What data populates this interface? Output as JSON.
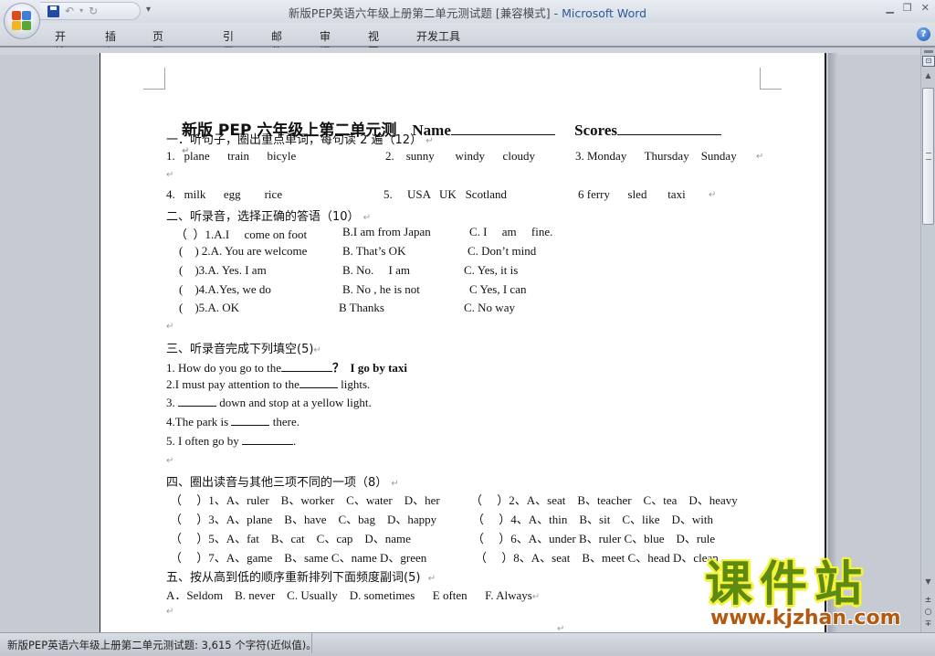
{
  "window": {
    "title_doc": "新版PEP英语六年级上册第二单元测试题 [兼容模式] - ",
    "title_app": "Microsoft Word",
    "controls": [
      "minimize",
      "restore",
      "close"
    ]
  },
  "quick_access": {
    "save": "save-icon",
    "undo": "↶",
    "undo_dropdown": "▾",
    "redo": "↻",
    "customize": "▾"
  },
  "ribbon": {
    "tabs": [
      "开始",
      "插入",
      "页面布局",
      "引用",
      "邮件",
      "审阅",
      "视图",
      "开发工具"
    ],
    "help": "?"
  },
  "document": {
    "title": {
      "text": "新版 PEP 六年级上第二单元测",
      "name_label": "Name",
      "scores_label": "Scores"
    },
    "section1": {
      "heading": "一．听句子，圈出重点单词，每句读 2 遍（12）",
      "row1": {
        "g1": "1.   plane      train      bicyle",
        "g2": "2.    sunny       windy      cloudy",
        "g3": "3. Monday      Thursday    Sunday"
      },
      "row2": {
        "g1": "4.   milk      egg        rice",
        "g2": "5.     USA   UK   Scotland",
        "g3": "6 ferry      sled       taxi"
      }
    },
    "section2": {
      "heading": "二、听录音，选择正确的答语（10）",
      "items": [
        {
          "a": "（  ）1.A.I     come on foot",
          "b": "B.I am from Japan",
          "c": "C. I     am     fine."
        },
        {
          "a": "(    ) 2.A. You are welcome",
          "b": "B. That’s OK",
          "c": "C. Don’t mind"
        },
        {
          "a": "(    )3.A. Yes. I am",
          "b": "B. No.     I am",
          "c": "C. Yes, it is"
        },
        {
          "a": "(    )4.A.Yes, we do",
          "b": "B. No , he is not",
          "c": "C Yes, I can"
        },
        {
          "a": "(    )5.A. OK",
          "b": "B Thanks",
          "c": "C. No way"
        }
      ]
    },
    "section3": {
      "heading": "三、听录音完成下列填空(5)",
      "items": [
        {
          "before": "1. How do you go to the",
          "after": "？  I go by taxi"
        },
        {
          "before": "2.I must pay attention to the",
          "after": " lights."
        },
        {
          "before": "3. ",
          "after": " down and stop at a yellow light."
        },
        {
          "before": "4.The park is ",
          "after": " there."
        },
        {
          "before": "5. I often go by ",
          "after": "."
        }
      ]
    },
    "section4": {
      "heading": "四、圈出读音与其他三项不同的一项（8）",
      "items": [
        {
          "left": "（     ）1、A、ruler    B、worker    C、water    D、her",
          "right": "（     ）2、A、seat    B、teacher    C、tea    D、heavy"
        },
        {
          "left": "（     ）3、A、plane    B、have    C、bag    D、happy",
          "right": "（     ）4、A、thin    B、sit    C、like    D、with"
        },
        {
          "left": "（     ）5、A、fat    B、cat    C、cap    D、name",
          "right": "（     ）6、A、under B、ruler C、blue    D、rule"
        },
        {
          "left": "（     ）7、A、game    B、same C、name D、green",
          "right": "（     ）8、A、seat    B、meet C、head D、clean"
        }
      ]
    },
    "section5": {
      "heading": "五、按从高到低的顺序重新排列下面频度副词(5)",
      "options": "A．Seldom    B. never    C. Usually    D. sometimes      E often      F. Always"
    },
    "paragraph_mark": "↵"
  },
  "statusbar": {
    "text": "新版PEP英语六年级上册第二单元测试题: 3,615 个字符(近似值)。"
  },
  "watermark": {
    "cn": "课件站",
    "url": "www.kjzhan.com"
  },
  "scrollbar": {
    "up": "▲",
    "down": "▼",
    "prev_page": "±",
    "browse": "○",
    "next_page": "∓"
  }
}
